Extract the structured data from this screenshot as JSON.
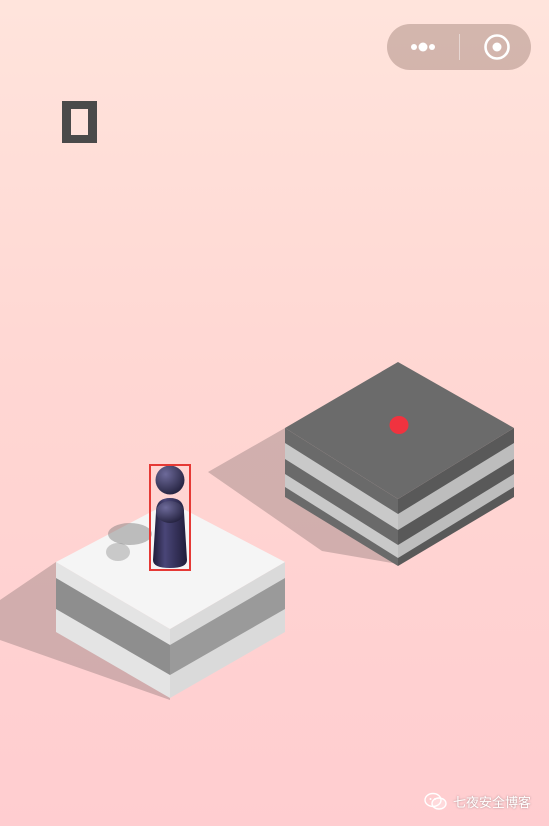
{
  "game": {
    "score": "0"
  },
  "capsule": {
    "more_icon": "more-dots-icon",
    "close_icon": "target-close-icon"
  },
  "watermark": {
    "icon": "wechat-icon",
    "text": "七夜安全博客"
  },
  "colors": {
    "player_body": "#2c2950",
    "target_dot": "#f0333f",
    "highlight_box": "#e53935",
    "current_block_top": "#f4f4f4",
    "next_block_top": "#6b6b6b"
  }
}
